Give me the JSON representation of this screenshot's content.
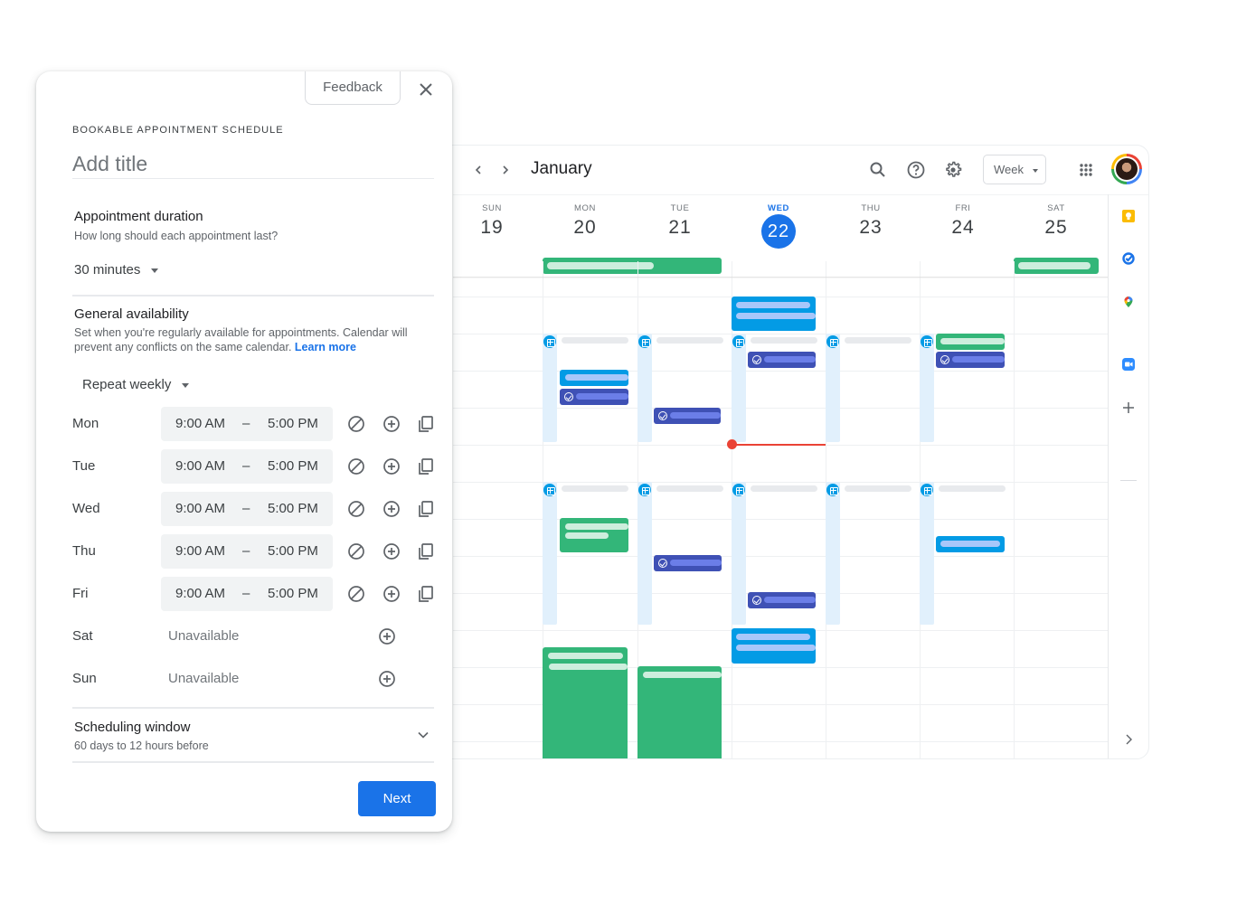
{
  "dialog": {
    "feedback_label": "Feedback",
    "kicker": "BOOKABLE APPOINTMENT SCHEDULE",
    "title_placeholder": "Add title",
    "title_value": "",
    "duration": {
      "title": "Appointment duration",
      "subtitle": "How long should each appointment last?",
      "value": "30 minutes"
    },
    "availability": {
      "title": "General availability",
      "description": "Set when you're regularly available for appointments. Calendar will prevent any conflicts on the same calendar.",
      "learn_more": "Learn more",
      "repeat": "Repeat weekly",
      "dash": "–",
      "days": [
        {
          "day": "Mon",
          "start": "9:00 AM",
          "end": "5:00 PM",
          "available": true
        },
        {
          "day": "Tue",
          "start": "9:00 AM",
          "end": "5:00 PM",
          "available": true
        },
        {
          "day": "Wed",
          "start": "9:00 AM",
          "end": "5:00 PM",
          "available": true
        },
        {
          "day": "Thu",
          "start": "9:00 AM",
          "end": "5:00 PM",
          "available": true
        },
        {
          "day": "Fri",
          "start": "9:00 AM",
          "end": "5:00 PM",
          "available": true
        },
        {
          "day": "Sat",
          "status": "Unavailable",
          "available": false
        },
        {
          "day": "Sun",
          "status": "Unavailable",
          "available": false
        }
      ]
    },
    "scheduling_window": {
      "title": "Scheduling window",
      "subtitle": "60 days to 12 hours before"
    },
    "next_label": "Next"
  },
  "calendar": {
    "month": "January",
    "view": "Week",
    "days": [
      {
        "dow": "SUN",
        "date": "19",
        "today": false
      },
      {
        "dow": "MON",
        "date": "20",
        "today": false
      },
      {
        "dow": "TUE",
        "date": "21",
        "today": false
      },
      {
        "dow": "WED",
        "date": "22",
        "today": true
      },
      {
        "dow": "THU",
        "date": "23",
        "today": false
      },
      {
        "dow": "FRI",
        "date": "24",
        "today": false
      },
      {
        "dow": "SAT",
        "date": "25",
        "today": false
      }
    ],
    "colors": {
      "today": "#1a73e8",
      "event_green": "#33b679",
      "event_blue": "#039be5",
      "task_indigo": "#3f51b5",
      "availability": "#e1f0fc",
      "now_line": "#ea4335"
    },
    "side_rail": [
      "keep-icon",
      "tasks-icon",
      "maps-icon",
      "zoom-meet-icon",
      "add-icon"
    ]
  }
}
